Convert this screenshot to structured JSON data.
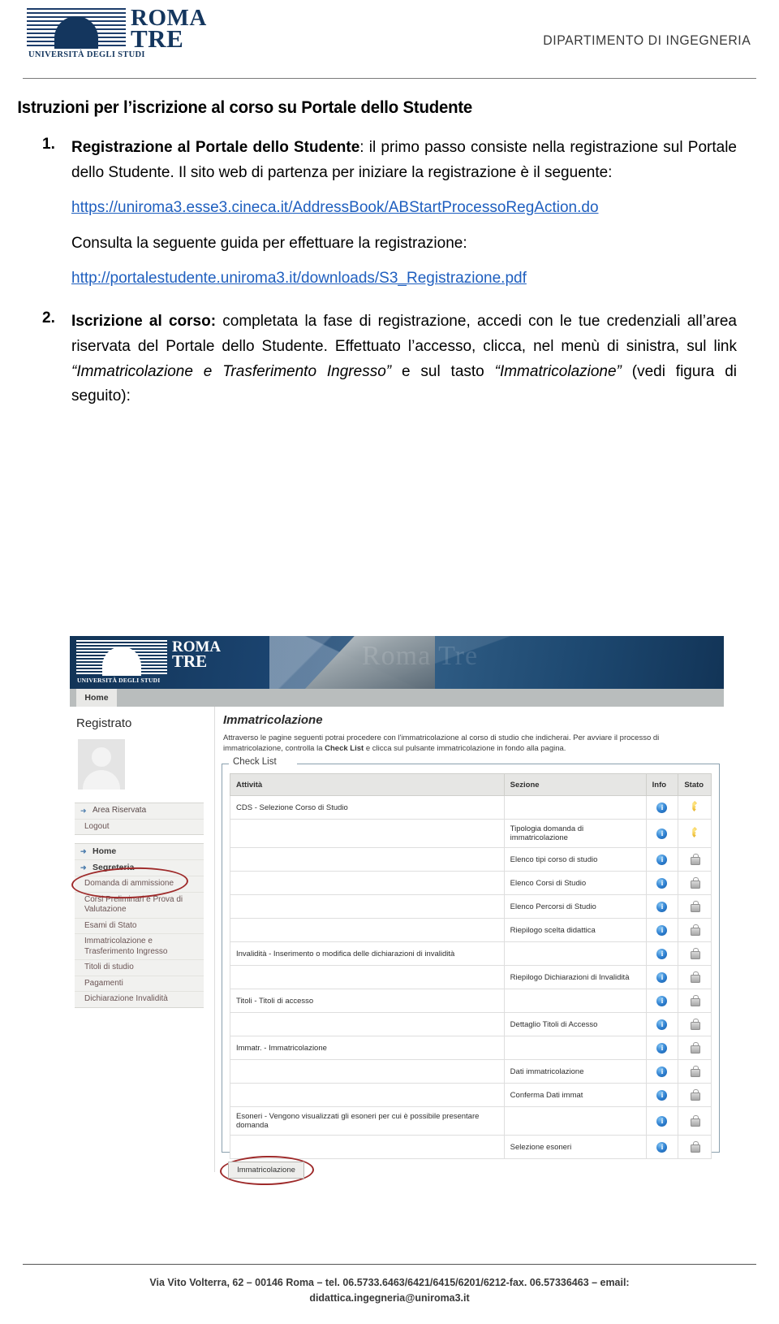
{
  "header": {
    "logo": {
      "line1": "ROMA",
      "line2": "TRE",
      "subtitle": "UNIVERSITÀ DEGLI STUDI"
    },
    "department": "DIPARTIMENTO DI INGEGNERIA"
  },
  "document": {
    "title": "Istruzioni per l’iscrizione al corso su Portale dello Studente",
    "steps": [
      {
        "number": "1.",
        "bold_lead": "Registrazione al Portale dello Studente",
        "text": ": il primo passo consiste nella registrazione sul Portale dello Studente. Il sito web di partenza per iniziare la registrazione è il seguente:",
        "link1": "https://uniroma3.esse3.cineca.it/AddressBook/ABStartProcessoRegAction.do",
        "after_link": "Consulta la seguente guida per effettuare la registrazione:",
        "link2": "http://portalestudente.uniroma3.it/downloads/S3_Registrazione.pdf"
      },
      {
        "number": "2.",
        "bold_lead": "Iscrizione al corso:",
        "text_part1": " completata la fase di registrazione, accedi con le tue credenziali all’area riservata del Portale dello Studente. Effettuato l’accesso, clicca, nel menù di sinistra, sul link ",
        "quote1": "“Immatricolazione e Trasferimento Ingresso”",
        "text_part2": " e sul tasto ",
        "quote2": "“Immatricolazione”",
        "text_part3": " (vedi figura di seguito):"
      }
    ]
  },
  "screenshot": {
    "banner_ghost_text": "Roma Tre",
    "tab_home": "Home",
    "sidebar": {
      "title": "Registrato",
      "group1": [
        {
          "label": "Area Riservata",
          "arrow": true
        },
        {
          "label": "Logout",
          "arrow": false
        }
      ],
      "group2": [
        {
          "label": "Home",
          "arrow": true,
          "top": true
        },
        {
          "label": "Segreteria",
          "arrow": true,
          "top": true
        },
        {
          "label": "Domanda di ammissione",
          "arrow": false
        },
        {
          "label": "Corsi Preliminari e Prova di Valutazione",
          "arrow": false
        },
        {
          "label": "Esami di Stato",
          "arrow": false
        },
        {
          "label": "Immatricolazione e Trasferimento Ingresso",
          "arrow": false,
          "highlighted": true
        },
        {
          "label": "Titoli di studio",
          "arrow": false
        },
        {
          "label": "Pagamenti",
          "arrow": false
        },
        {
          "label": "Dichiarazione Invalidità",
          "arrow": false
        }
      ]
    },
    "main": {
      "title": "Immatricolazione",
      "description_part1": "Attraverso le pagine seguenti potrai procedere con l'immatricolazione al corso di studio che indicherai. Per avviare il processo di immatricolazione, controlla la ",
      "description_bold": "Check List",
      "description_part2": " e clicca sul pulsante immatricolazione in fondo alla pagina.",
      "checklist_legend": "Check List",
      "columns": [
        "Attività",
        "Sezione",
        "Info",
        "Stato"
      ],
      "rows": [
        {
          "attivita": "CDS - Selezione Corso di Studio",
          "sezione": "",
          "info": "info-icon",
          "stato": "key-icon"
        },
        {
          "attivita": "",
          "sezione": "Tipologia domanda di immatricolazione",
          "info": "info-icon",
          "stato": "key-icon"
        },
        {
          "attivita": "",
          "sezione": "Elenco tipi corso di studio",
          "info": "info-icon",
          "stato": "lock-icon"
        },
        {
          "attivita": "",
          "sezione": "Elenco Corsi di Studio",
          "info": "info-icon",
          "stato": "lock-icon"
        },
        {
          "attivita": "",
          "sezione": "Elenco Percorsi di Studio",
          "info": "info-icon",
          "stato": "lock-icon"
        },
        {
          "attivita": "",
          "sezione": "Riepilogo scelta didattica",
          "info": "info-icon",
          "stato": "lock-icon"
        },
        {
          "attivita": "Invalidità - Inserimento o modifica delle dichiarazioni di invalidità",
          "sezione": "",
          "info": "info-icon",
          "stato": "lock-icon"
        },
        {
          "attivita": "",
          "sezione": "Riepilogo Dichiarazioni di Invalidità",
          "info": "info-icon",
          "stato": "lock-icon"
        },
        {
          "attivita": "Titoli - Titoli di accesso",
          "sezione": "",
          "info": "info-icon",
          "stato": "lock-icon"
        },
        {
          "attivita": "",
          "sezione": "Dettaglio Titoli di Accesso",
          "info": "info-icon",
          "stato": "lock-icon"
        },
        {
          "attivita": "Immatr. - Immatricolazione",
          "sezione": "",
          "info": "info-icon",
          "stato": "lock-icon"
        },
        {
          "attivita": "",
          "sezione": "Dati immatricolazione",
          "info": "info-icon",
          "stato": "lock-icon"
        },
        {
          "attivita": "",
          "sezione": "Conferma Dati immat",
          "info": "info-icon",
          "stato": "lock-icon"
        },
        {
          "attivita": "Esoneri - Vengono visualizzati gli esoneri per cui è possibile presentare domanda",
          "sezione": "",
          "info": "info-icon",
          "stato": "lock-icon"
        },
        {
          "attivita": "",
          "sezione": "Selezione esoneri",
          "info": "info-icon",
          "stato": "lock-icon"
        }
      ],
      "submit_button": "Immatricolazione"
    }
  },
  "footer": {
    "line1": "Via Vito Volterra, 62 – 00146 Roma – tel. 06.5733.6463/6421/6415/6201/6212-fax. 06.57336463 – email:",
    "line2": "didattica.ingegneria@uniroma3.it"
  }
}
